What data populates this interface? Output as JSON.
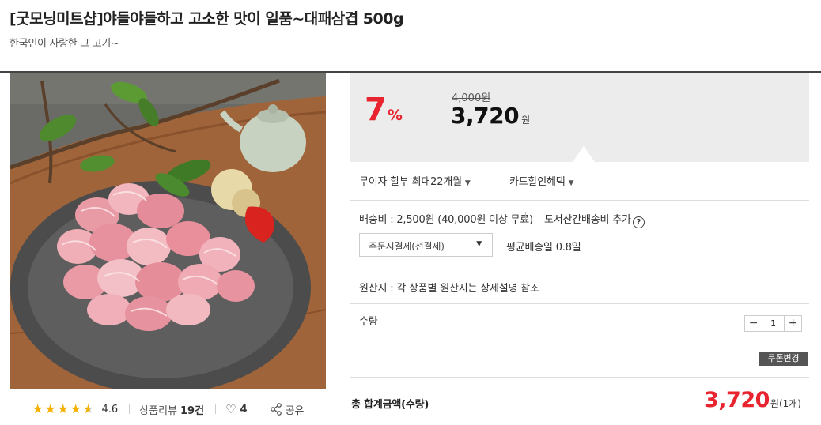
{
  "product": {
    "title": "[굿모닝미트샵]야들야들하고 고소한 맛이 일품~대패삼겹 500g",
    "subtitle": "한국인이 사랑한 그 고기~"
  },
  "image": {
    "alt": "대패삼겹 product photo"
  },
  "rating": {
    "score": "4.6",
    "stars": 4.6,
    "review_label": "상품리뷰",
    "review_count": "19건",
    "like_count": "4",
    "share_label": "공유"
  },
  "price": {
    "discount": "7",
    "discount_unit": "%",
    "original": "4,000원",
    "sale": "3,720",
    "sale_unit": "원"
  },
  "options": {
    "installment": "무이자 할부 최대22개월",
    "card_benefit": "카드할인혜택"
  },
  "shipping": {
    "fee": "배송비 : 2,500원 (40,000원 이상 무료)",
    "extra": "도서산간배송비 추가",
    "payment_select": "주문시결제(선결제)",
    "avg_delivery": "평균배송일 0.8일"
  },
  "origin": "원산지 : 각 상품별 원산지는 상세설명 참조",
  "quantity": {
    "label": "수량",
    "minus": "−",
    "value": "1",
    "plus": "+"
  },
  "coupon": {
    "label": "쿠폰변경"
  },
  "total": {
    "label": "총 합계금액(수량)",
    "amount": "3,720",
    "unit": "원(1개)"
  },
  "colors": {
    "accent_red": "#e8242f",
    "star": "#f6b000",
    "panel_bg": "#ececec"
  }
}
